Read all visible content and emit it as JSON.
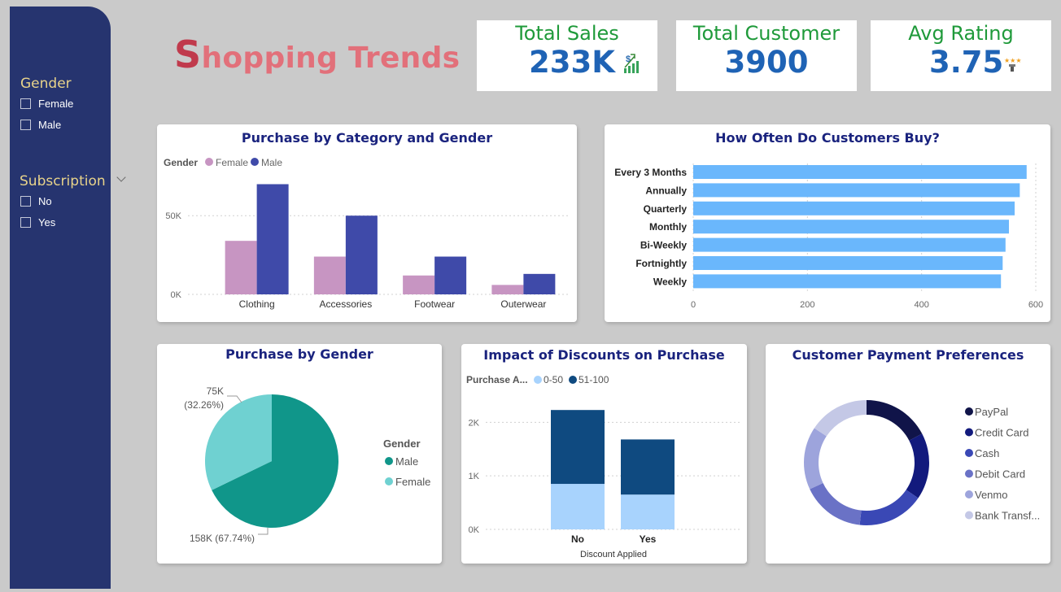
{
  "slicers": {
    "gender": {
      "title": "Gender",
      "options": [
        "Female",
        "Male"
      ]
    },
    "subscription": {
      "title": "Subscription",
      "options": [
        "No",
        "Yes"
      ]
    }
  },
  "header": {
    "title_first": "S",
    "title_rest": "hopping Trends"
  },
  "kpis": {
    "sales": {
      "label": "Total Sales",
      "value": "233K",
      "icon": "sales-chart-icon"
    },
    "customers": {
      "label": "Total Customer",
      "value": "3900"
    },
    "rating": {
      "label": "Avg Rating",
      "value": "3.75",
      "icon": "star-rating-icon"
    }
  },
  "colors": {
    "female": "#c795c2",
    "male": "#3f4aa9",
    "freq_bar": "#6ab7fc",
    "pie_male": "#10968a",
    "pie_female": "#6fd1d1",
    "disc_low": "#a8d3fd",
    "disc_high": "#0f4a80",
    "kpi_label": "#1f9a3a",
    "kpi_value": "#1f63b5"
  },
  "chart_data": [
    {
      "id": "category_gender",
      "type": "bar",
      "title": "Purchase by Category and Gender",
      "legend_title": "Gender",
      "categories": [
        "Clothing",
        "Accessories",
        "Footwear",
        "Outerwear"
      ],
      "series": [
        {
          "name": "Female",
          "values": [
            34000,
            24000,
            12000,
            6000
          ]
        },
        {
          "name": "Male",
          "values": [
            70000,
            50000,
            24000,
            13000
          ]
        }
      ],
      "yticks": [
        {
          "value": 0,
          "label": "0K"
        },
        {
          "value": 50000,
          "label": "50K"
        }
      ],
      "ylim": [
        0,
        78000
      ],
      "grid": true,
      "legend_position": "top-left"
    },
    {
      "id": "frequency",
      "type": "bar",
      "orientation": "horizontal",
      "title": "How Often Do Customers Buy?",
      "categories": [
        "Every 3 Months",
        "Annually",
        "Quarterly",
        "Monthly",
        "Bi-Weekly",
        "Fortnightly",
        "Weekly"
      ],
      "values": [
        584,
        572,
        563,
        553,
        547,
        542,
        539
      ],
      "xticks": [
        0,
        200,
        400,
        600
      ],
      "xlim": [
        0,
        600
      ],
      "grid": true
    },
    {
      "id": "gender_pie",
      "type": "pie",
      "title": "Purchase by Gender",
      "legend_title": "Gender",
      "slices": [
        {
          "name": "Male",
          "value": 158000,
          "label": "158K (67.74%)"
        },
        {
          "name": "Female",
          "value": 75000,
          "label_value": "75K",
          "label_pct": "(32.26%)"
        }
      ],
      "legend_position": "right"
    },
    {
      "id": "discount",
      "type": "bar",
      "stacked": true,
      "title": "Impact of Discounts on Purchase",
      "legend_title": "Purchase A...",
      "xlabel": "Discount Applied",
      "categories": [
        "No",
        "Yes"
      ],
      "series": [
        {
          "name": "0-50",
          "values": [
            850,
            650
          ]
        },
        {
          "name": "51-100",
          "values": [
            1380,
            1030
          ]
        }
      ],
      "yticks": [
        {
          "value": 0,
          "label": "0K"
        },
        {
          "value": 1000,
          "label": "1K"
        },
        {
          "value": 2000,
          "label": "2K"
        }
      ],
      "ylim": [
        0,
        2400
      ],
      "grid": true,
      "legend_position": "top-left"
    },
    {
      "id": "payment",
      "type": "pie",
      "donut": true,
      "title": "Customer Payment Preferences",
      "slices": [
        {
          "name": "PayPal",
          "value": 677,
          "color": "#101449"
        },
        {
          "name": "Credit Card",
          "value": 671,
          "color": "#121a7d"
        },
        {
          "name": "Cash",
          "value": 670,
          "color": "#3a48b5"
        },
        {
          "name": "Debit Card",
          "value": 636,
          "color": "#6a72c6"
        },
        {
          "name": "Venmo",
          "value": 634,
          "color": "#9da4dc"
        },
        {
          "name": "Bank Transf...",
          "value": 612,
          "color": "#c4c8e6"
        }
      ],
      "legend_position": "right"
    }
  ]
}
